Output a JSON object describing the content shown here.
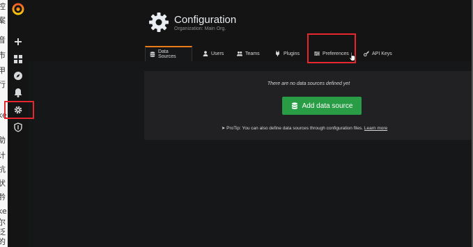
{
  "left_strip_chars": [
    "控",
    "案",
    "音",
    "市",
    "甲",
    "行",
    "ke",
    "助",
    "计",
    "抗",
    "状",
    "黔",
    "ke",
    "尔",
    "泛",
    "的"
  ],
  "sidebar": {
    "items": [
      {
        "name": "grafana-logo",
        "icon": "grafana-logo"
      },
      {
        "name": "create",
        "icon": "plus-icon"
      },
      {
        "name": "dashboards",
        "icon": "dashboards-icon"
      },
      {
        "name": "explore",
        "icon": "compass-icon"
      },
      {
        "name": "alerting",
        "icon": "bell-icon"
      },
      {
        "name": "configuration",
        "icon": "gear-icon"
      },
      {
        "name": "server-admin",
        "icon": "shield-icon"
      }
    ]
  },
  "header": {
    "title": "Configuration",
    "subtitle": "Organization: Main Org."
  },
  "tabs": [
    {
      "label": "Data Sources",
      "icon": "database-icon",
      "active": true
    },
    {
      "label": "Users",
      "icon": "user-icon",
      "active": false
    },
    {
      "label": "Teams",
      "icon": "users-icon",
      "active": false
    },
    {
      "label": "Plugins",
      "icon": "plug-icon",
      "active": false
    },
    {
      "label": "Preferences",
      "icon": "sliders-icon",
      "active": false
    },
    {
      "label": "API Keys",
      "icon": "key-icon",
      "active": false
    }
  ],
  "empty_state": {
    "message": "There are no data sources defined yet",
    "button_label": "Add data source",
    "protip_text": "ProTip: You can also define data sources through configuration files.",
    "protip_link": "Learn more"
  },
  "colors": {
    "accent_active_tab": "#eb7b18",
    "button_green": "#299c46",
    "highlight_red": "#e8262d"
  }
}
